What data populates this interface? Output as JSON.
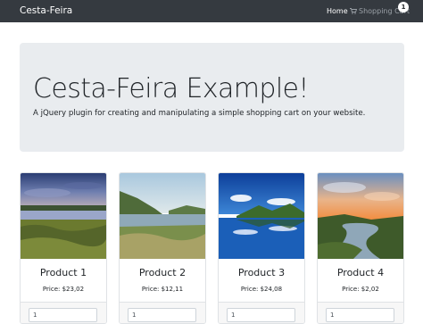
{
  "navbar": {
    "brand": "Cesta-Feira",
    "home_label": "Home",
    "cart_label": "Shopping Cart",
    "cart_icon": "shopping-cart-icon",
    "cart_count": "1"
  },
  "jumbotron": {
    "title": "Cesta-Feira Example!",
    "lead": "A jQuery plugin for creating and manipulating a simple shopping cart on your website."
  },
  "products": [
    {
      "name": "Product 1",
      "price": "Price: $23,02",
      "quantity": "1",
      "image": "lake-sunset-landscape"
    },
    {
      "name": "Product 2",
      "price": "Price: $12,11",
      "quantity": "1",
      "image": "river-valley-landscape"
    },
    {
      "name": "Product 3",
      "price": "Price: $24,08",
      "quantity": "1",
      "image": "blue-lake-reflection-landscape"
    },
    {
      "name": "Product 4",
      "price": "Price: $2,02",
      "quantity": "1",
      "image": "river-bend-sunset-landscape"
    }
  ],
  "colors": {
    "navbar_bg": "#353a40",
    "jumbotron_bg": "#e9ecef",
    "text": "#212529",
    "muted_link": "#9aa0a6"
  }
}
